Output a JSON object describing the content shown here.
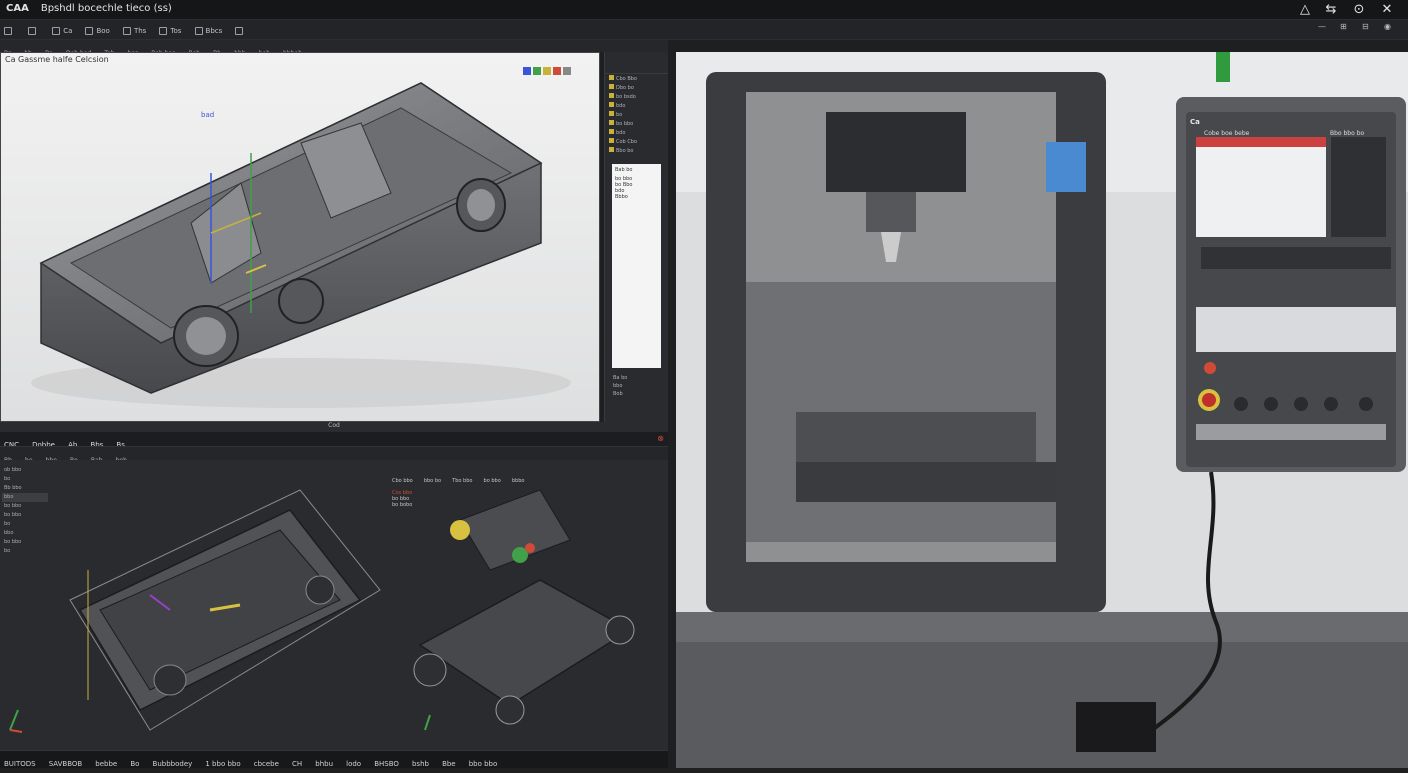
{
  "titlebar": {
    "app": "CAA",
    "title": "Bpshdl bocechle tieco (ss)",
    "controls": [
      "minimize-icon",
      "restore-icon",
      "help-icon",
      "close-icon"
    ]
  },
  "toolbar": {
    "items": [
      "Ca",
      "Boo",
      "Ths",
      "Tos",
      "Bbcs"
    ],
    "right_icons": [
      "minimize-icon",
      "layout-icon",
      "layout-icon",
      "camera-icon"
    ]
  },
  "toolbar2": {
    "items": [
      "Bs",
      "bb",
      "Ba",
      "Dob bod",
      "Tob",
      "bos",
      "Bob bos",
      "Bob",
      "Bb",
      "bbb",
      "bob",
      "bbbob"
    ]
  },
  "cad": {
    "title": "Ca Gassme halfe Celcsion",
    "annotation": "bad",
    "status": "Cod",
    "side": {
      "rows": [
        "Cbo Bbo",
        "Dbo bo",
        "bo bsdo",
        "bdo",
        "bo",
        "bo bbo",
        "bdo",
        "Cob Cbo",
        "Bbo bo"
      ],
      "panel_rows": [
        "Bab bo",
        "bo bbo",
        "bo Bbo",
        "bdo",
        "Bbbo"
      ],
      "footer": [
        "Ba bo",
        "bbo",
        "Bob"
      ]
    }
  },
  "cam": {
    "menu": [
      "CNC",
      "Dobbe",
      "Ab",
      "Bbs",
      "Bs"
    ],
    "toolbar": [
      "Bb",
      "be",
      "bbo",
      "Bo",
      "Bab",
      "bob"
    ],
    "tree": [
      "ob bbo",
      "bo",
      "Bb bbo",
      "bbo",
      "bo bbo",
      "bo bbo",
      "bo",
      "bbo",
      "bo bbo",
      "bo",
      "bbo bo",
      "bo bbo"
    ],
    "labels": [
      "Cbo bbo",
      "bbo bo",
      "Tbo bbo",
      "bo bbo",
      "bbbo"
    ],
    "label_block": [
      "Cos bbo",
      "bo bbo",
      "bo bobo"
    ],
    "status": [
      "BUITODS",
      "SAVBBOB",
      "bebbe",
      "Bo",
      "Bubbbodey",
      "1 bbo bbo",
      "cbcebe",
      "CH",
      "bhbu",
      "lodo",
      "BHSBO",
      "bshb",
      "Bbe",
      "bbo bbo"
    ]
  },
  "machine": {
    "hmi_logo": "Ca",
    "hmi_title": "Cobe boe bebe",
    "hmi_title2": "Bbo bbo bo"
  }
}
